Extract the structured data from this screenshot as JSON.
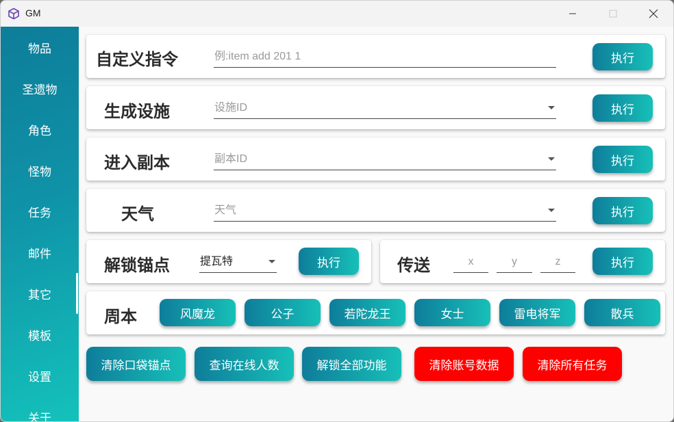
{
  "window": {
    "title": "GM"
  },
  "sidebar": {
    "items": [
      {
        "label": "物品"
      },
      {
        "label": "圣遗物"
      },
      {
        "label": "角色"
      },
      {
        "label": "怪物"
      },
      {
        "label": "任务"
      },
      {
        "label": "邮件"
      },
      {
        "label": "其它"
      },
      {
        "label": "模板"
      },
      {
        "label": "设置"
      },
      {
        "label": "关于"
      }
    ],
    "selected": "其它"
  },
  "custom_command": {
    "label": "自定义指令",
    "placeholder": "例:item add 201 1",
    "button": "执行"
  },
  "spawn_facility": {
    "label": "生成设施",
    "placeholder": "设施ID",
    "button": "执行"
  },
  "enter_dungeon": {
    "label": "进入副本",
    "placeholder": "副本ID",
    "button": "执行"
  },
  "weather": {
    "label": "天气",
    "placeholder": "天气",
    "button": "执行"
  },
  "unlock_anchor": {
    "label": "解锁锚点",
    "value": "提瓦特",
    "button": "执行"
  },
  "teleport": {
    "label": "传送",
    "x": "x",
    "y": "y",
    "z": "z",
    "button": "执行"
  },
  "weekly_boss": {
    "label": "周本",
    "bosses": [
      "风魔龙",
      "公子",
      "若陀龙王",
      "女士",
      "雷电将军",
      "散兵"
    ]
  },
  "actions": [
    {
      "label": "清除口袋锚点",
      "color": "teal"
    },
    {
      "label": "查询在线人数",
      "color": "teal"
    },
    {
      "label": "解锁全部功能",
      "color": "teal"
    },
    {
      "label": "清除账号数据",
      "color": "#ff0000"
    },
    {
      "label": "清除所有任务",
      "color": "#ff0000"
    }
  ],
  "colors": {
    "accent_start": "#0e7d9a",
    "accent_end": "#17c0b8",
    "danger": "#ff0000"
  }
}
